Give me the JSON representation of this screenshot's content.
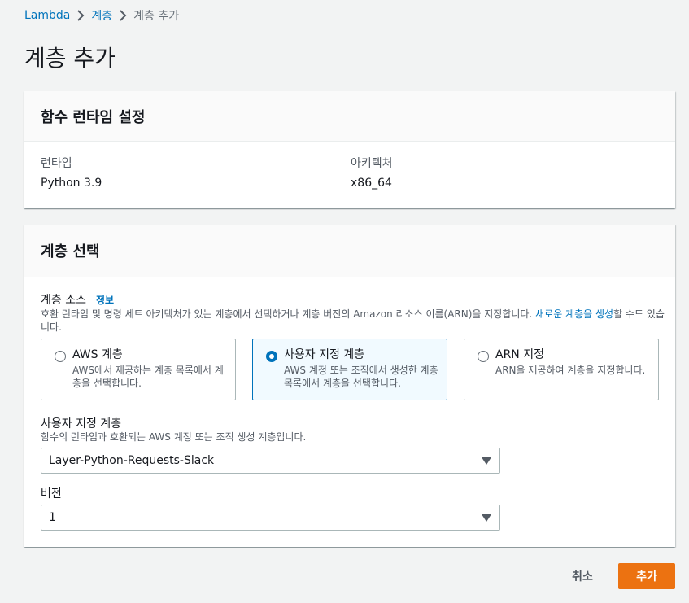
{
  "breadcrumb": {
    "items": [
      {
        "label": "Lambda"
      },
      {
        "label": "계층"
      },
      {
        "label": "계층 추가"
      }
    ]
  },
  "page": {
    "title": "계층 추가"
  },
  "runtime_settings": {
    "title": "함수 런타임 설정",
    "runtime_label": "런타임",
    "runtime_value": "Python 3.9",
    "arch_label": "아키텍처",
    "arch_value": "x86_64"
  },
  "layer_select": {
    "title": "계층 선택",
    "source_label": "계층 소스",
    "info_link": "정보",
    "source_desc_pre": "호환 런타임 및 명령 세트 아키텍처가 있는 계층에서 선택하거나 계층 버전의 Amazon 리소스 이름(ARN)을 지정합니다. ",
    "source_desc_link": "새로운 계층을 생성",
    "source_desc_post": "할 수도 있습니다.",
    "options": [
      {
        "title": "AWS 계층",
        "desc": "AWS에서 제공하는 계층 목록에서 계층을 선택합니다."
      },
      {
        "title": "사용자 지정 계층",
        "desc": "AWS 계정 또는 조직에서 생성한 계층 목록에서 계층을 선택합니다."
      },
      {
        "title": "ARN 지정",
        "desc": "ARN을 제공하여 계층을 지정합니다."
      }
    ],
    "selected_option": "사용자 지정 계층",
    "custom_label": "사용자 지정 계층",
    "custom_desc": "함수의 런타임과 호환되는 AWS 계정 또는 조직 생성 계층입니다.",
    "custom_value": "Layer-Python-Requests-Slack",
    "version_label": "버전",
    "version_value": "1"
  },
  "actions": {
    "cancel": "취소",
    "add": "추가"
  },
  "colors": {
    "accent": "#0073bb",
    "primary_button": "#ec7211",
    "background": "#f2f3f3"
  }
}
